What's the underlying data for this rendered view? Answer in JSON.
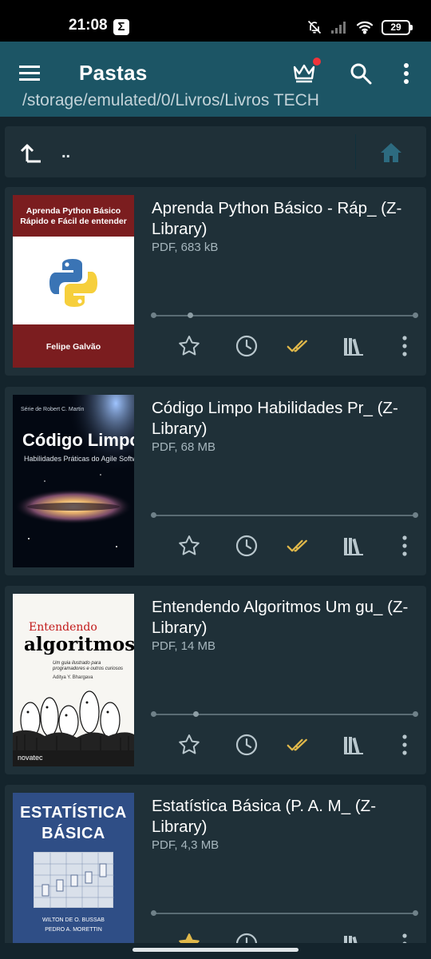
{
  "status_bar": {
    "time": "21:08",
    "notification_icon": "sigma-icon",
    "notification_glyph": "Σ",
    "battery": "29",
    "icons": [
      "bell-off-icon",
      "signal-icon",
      "wifi-icon",
      "battery-icon"
    ]
  },
  "app_bar": {
    "title": "Pastas",
    "path": "/storage/emulated/0/Livros/Livros TECH",
    "icons": [
      "menu-icon",
      "crown-icon",
      "search-icon",
      "more-vert-icon"
    ],
    "background": "#1c5565"
  },
  "nav_row": {
    "up_label": "..",
    "icons": [
      "arrow-up-icon",
      "home-icon"
    ]
  },
  "books": [
    {
      "title": "Aprenda Python Básico - Ráp_ (Z-Library)",
      "meta": "PDF, 683 kB",
      "progress": 0.14,
      "cover": {
        "top_line1": "Aprenda Python Básico",
        "top_line2": "Rápido e Fácil de entender",
        "author": "Felipe Galvão"
      }
    },
    {
      "title": "Código Limpo Habilidades Pr_ (Z-Library)",
      "meta": "PDF, 68 MB",
      "progress": 0.0,
      "cover": {
        "series": "Série de Robert C. Martin",
        "title": "Código Limpo",
        "subtitle": "Habilidades Práticas do Agile Software"
      }
    },
    {
      "title": "Entendendo Algoritmos Um gu_ (Z-Library)",
      "meta": "PDF, 14 MB",
      "progress": 0.16,
      "cover": {
        "line1": "Entendendo",
        "line2": "algoritmos",
        "desc": "Um guia ilustrado para programadores e outros curiosos",
        "author": "Aditya Y. Bhargava",
        "publisher": "novatec"
      }
    },
    {
      "title": "Estatística Básica (P. A. M_ (Z-Library)",
      "meta": "PDF, 4,3 MB",
      "progress": 0.0,
      "cover": {
        "line1": "ESTATÍSTICA",
        "line2": "BÁSICA",
        "author1": "WILTON DE O. BUSSAB",
        "author2": "PEDRO A. MORETTIN"
      }
    }
  ],
  "actions": [
    "star-icon",
    "history-icon",
    "done-all-icon",
    "library-icon",
    "more-vert-icon"
  ],
  "colors": {
    "background": "#14242c",
    "card": "#1f3038",
    "accent_check": "#e0b84a",
    "icon": "#b9c7cd"
  }
}
